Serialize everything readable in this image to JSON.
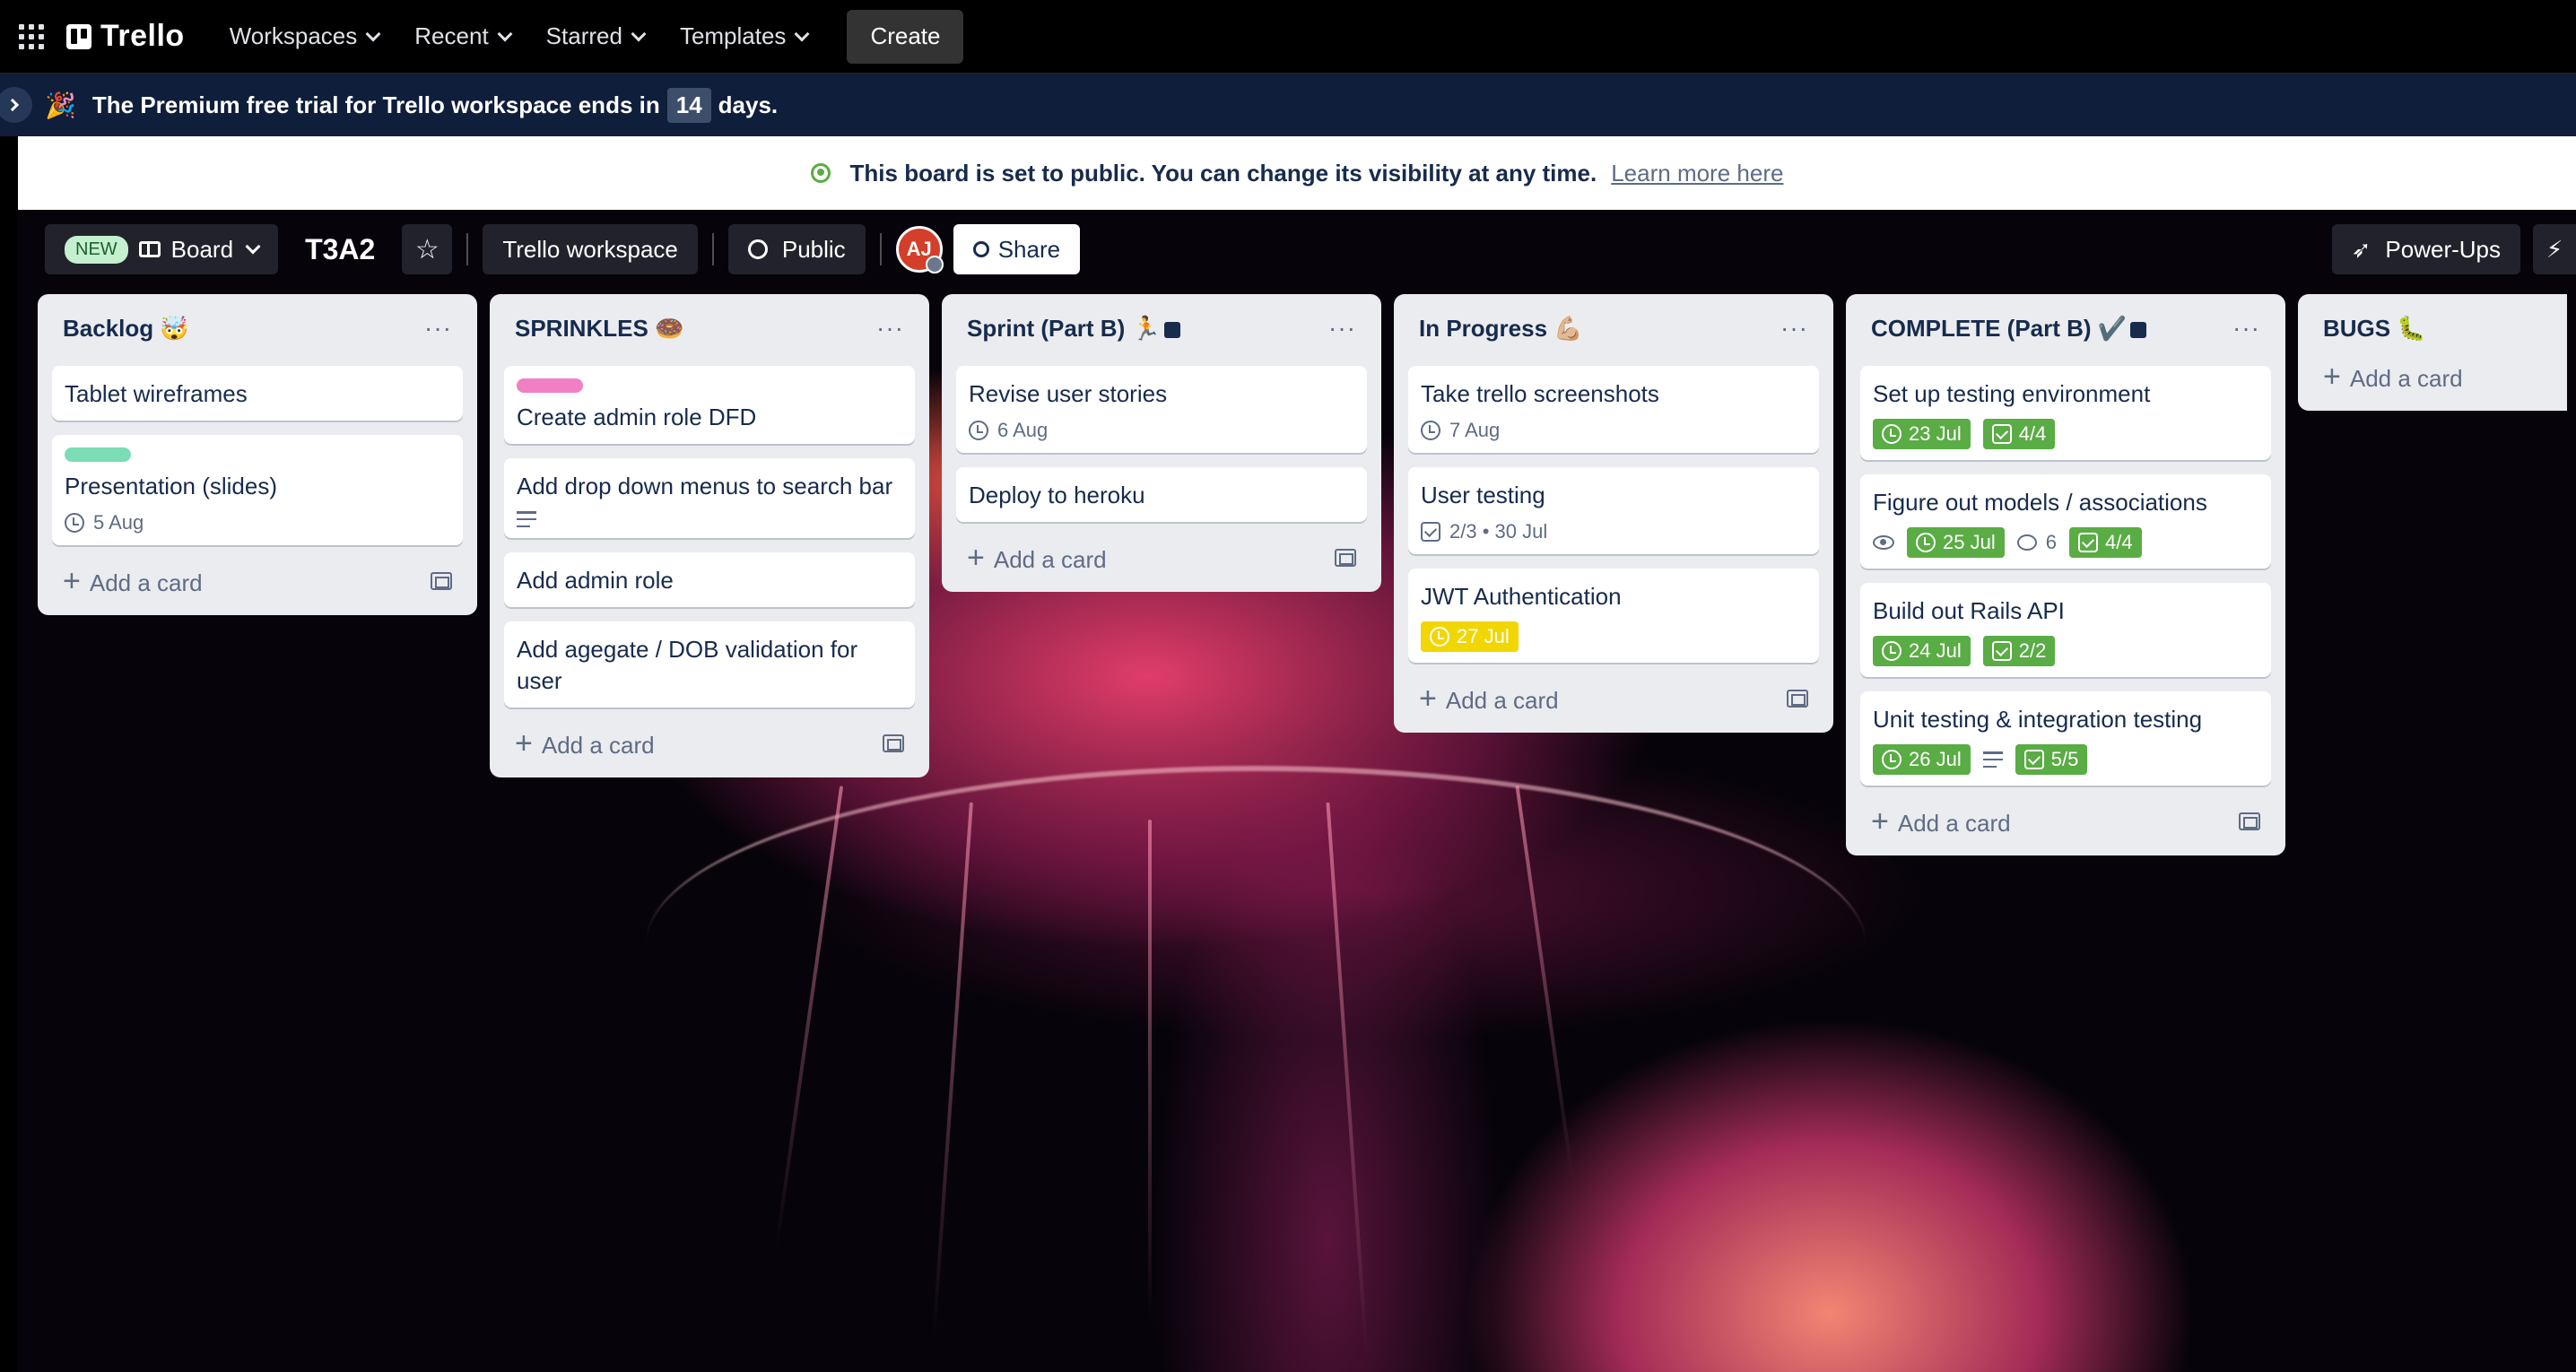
{
  "nav": {
    "logo": "Trello",
    "items": [
      "Workspaces",
      "Recent",
      "Starred",
      "Templates"
    ],
    "create": "Create"
  },
  "trial": {
    "emoji": "🎉",
    "text_before": "The Premium free trial for Trello workspace ends in",
    "days": "14",
    "text_after": "days."
  },
  "public_notice": {
    "text": "This board is set to public. You can change its visibility at any time.",
    "link": "Learn more here"
  },
  "board": {
    "new_badge": "NEW",
    "view": "Board",
    "title": "T3A2",
    "star": "☆",
    "workspace": "Trello workspace",
    "visibility": "Public",
    "avatar": "AJ",
    "share": "Share",
    "powerups": "Power-Ups",
    "automation": "⚡"
  },
  "lists": [
    {
      "title": "Backlog 🤯",
      "menu": "···",
      "add": "Add a card",
      "cards": [
        {
          "title": "Tablet wireframes"
        },
        {
          "title": "Presentation (slides)",
          "label_color": "#7bdcb5",
          "due": "5 Aug"
        }
      ]
    },
    {
      "title": "SPRINKLES 🍩",
      "menu": "···",
      "add": "Add a card",
      "cards": [
        {
          "title": "Create admin role DFD",
          "label_color": "#f07fc4"
        },
        {
          "title": "Add drop down menus to search bar"
        },
        {
          "title": "Add admin role"
        },
        {
          "title": "Add agegate / DOB validation for user"
        }
      ]
    },
    {
      "title": "Sprint (Part B) 🏃",
      "menu": "···",
      "add": "Add a card",
      "cards": [
        {
          "title": "Revise user stories",
          "due": "6 Aug"
        },
        {
          "title": "Deploy to heroku"
        }
      ]
    },
    {
      "title": "In Progress 💪🏼",
      "menu": "···",
      "add": "Add a card",
      "cards": [
        {
          "title": "Take trello screenshots",
          "due": "7 Aug"
        },
        {
          "title": "User testing",
          "checklist": "2/3 • 30 Jul"
        },
        {
          "title": "JWT Authentication",
          "due": "27 Jul"
        }
      ]
    },
    {
      "title": "COMPLETE (Part B) ✔️",
      "menu": "···",
      "add": "Add a card",
      "cards": [
        {
          "title": "Set up testing environment",
          "due": "23 Jul",
          "checklist": "4/4"
        },
        {
          "title": "Figure out models / associations",
          "due": "25 Jul",
          "comments": "6",
          "checklist": "4/4"
        },
        {
          "title": "Build out Rails API",
          "due": "24 Jul",
          "checklist": "2/2"
        },
        {
          "title": "Unit testing & integration testing",
          "due": "26 Jul",
          "checklist": "5/5"
        }
      ]
    },
    {
      "title": "BUGS 🐛",
      "add": "Add a card",
      "cards": []
    }
  ],
  "colors": {
    "complete_green": "#5aac44",
    "due_soon_yellow": "#f2d600",
    "banner_navy": "#0f1e3b"
  }
}
